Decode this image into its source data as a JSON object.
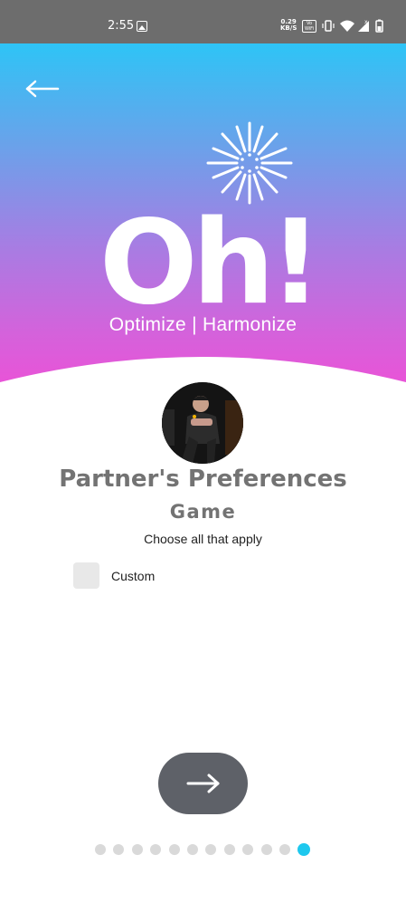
{
  "status_bar": {
    "time": "2:55",
    "network_speed": "0.29",
    "network_unit": "KB/S",
    "volte_top": "Vo",
    "volte_bottom": "WiFi",
    "icons": [
      "image-icon",
      "vibrate-icon",
      "wifi-icon",
      "signal-icon",
      "battery-icon"
    ]
  },
  "header": {
    "logo_text": "Oh!",
    "tagline": "Optimize | Harmonize"
  },
  "colors": {
    "gradient_top": "#2ec4f6",
    "gradient_bottom": "#f24dd6",
    "heading_gray": "#737373",
    "button_gray": "#5e6168",
    "active_dot": "#1ec8ee"
  },
  "main": {
    "title": "Partner's Preferences",
    "subtitle": "Game",
    "instruction": "Choose all that apply",
    "options": [
      {
        "label": "Custom",
        "checked": false
      }
    ]
  },
  "pager": {
    "total": 12,
    "active_index": 11
  }
}
